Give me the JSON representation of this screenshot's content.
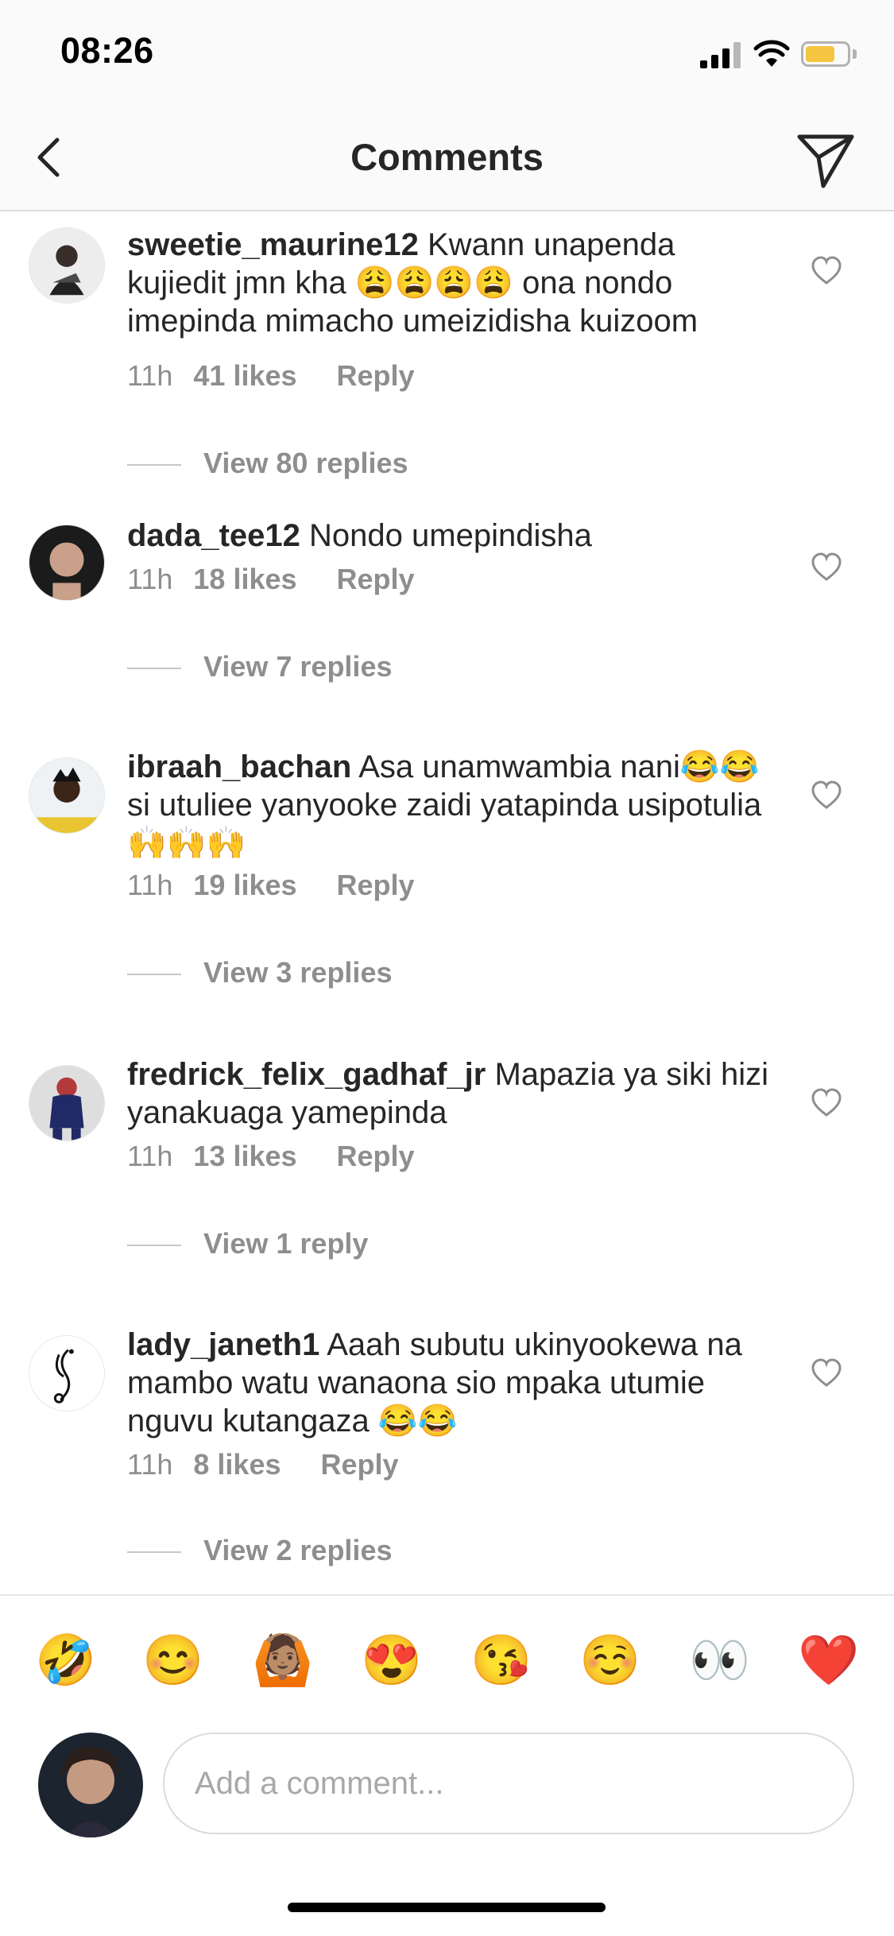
{
  "status_bar": {
    "time": "08:26"
  },
  "nav": {
    "title": "Comments"
  },
  "comments": [
    {
      "username": "sweetie_maurine12",
      "text": "Kwann unapenda kujiedit jmn kha 😩😩😩😩 ona nondo imepinda mimacho umeizidisha kuizoom",
      "time": "11h",
      "likes": "41 likes",
      "reply": "Reply",
      "view_replies": "View 80 replies"
    },
    {
      "username": "dada_tee12",
      "text": "Nondo umepindisha",
      "time": "11h",
      "likes": "18 likes",
      "reply": "Reply",
      "view_replies": "View 7 replies"
    },
    {
      "username": "ibraah_bachan",
      "text": "Asa unamwambia nani😂😂si utuliee yanyooke zaidi yatapinda usipotulia🙌🙌🙌",
      "time": "11h",
      "likes": "19 likes",
      "reply": "Reply",
      "view_replies": "View 3 replies"
    },
    {
      "username": "fredrick_felix_gadhaf_jr",
      "text": "Mapazia ya siki hizi yanakuaga yamepinda",
      "time": "11h",
      "likes": "13 likes",
      "reply": "Reply",
      "view_replies": "View 1 reply"
    },
    {
      "username": "lady_janeth1",
      "text": "Aaah subutu ukinyookewa na mambo watu wanaona sio mpaka utumie nguvu kutangaza 😂😂",
      "time": "11h",
      "likes": "8 likes",
      "reply": "Reply",
      "view_replies": "View 2 replies"
    }
  ],
  "emoji_bar": [
    "🤣",
    "😊",
    "🙆🏽",
    "😍",
    "😘",
    "☺️",
    "👀",
    "❤️"
  ],
  "composer": {
    "placeholder": "Add a comment..."
  },
  "colors": {
    "accent_battery": "#f5c542",
    "muted_text": "#8e8e8e",
    "border": "#dbdbdb"
  }
}
